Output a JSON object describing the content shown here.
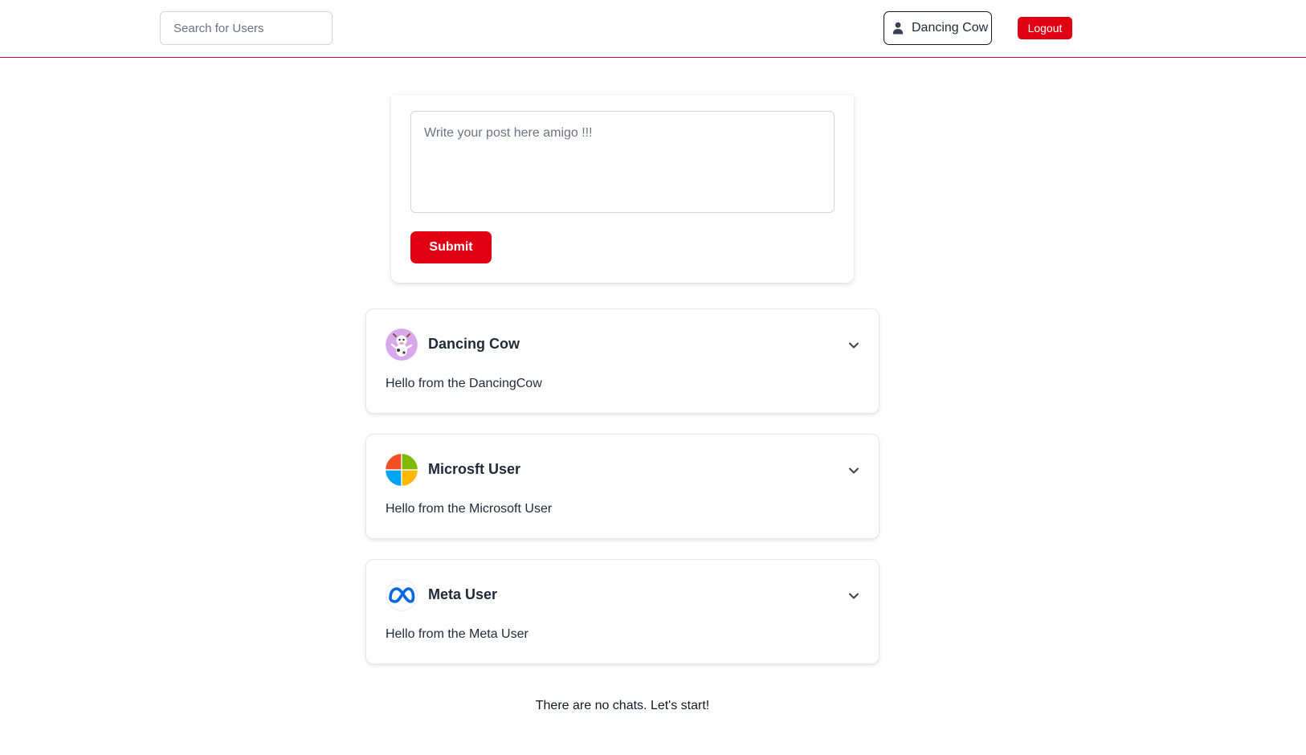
{
  "header": {
    "search_placeholder": "Search for Users",
    "current_user": "Dancing Cow",
    "logout_label": "Logout"
  },
  "composer": {
    "placeholder": "Write your post here amigo !!!",
    "submit_label": "Submit"
  },
  "posts": [
    {
      "author": "Dancing Cow",
      "body": "Hello from the DancingCow",
      "avatar": "cow-avatar"
    },
    {
      "author": "Microsft User",
      "body": "Hello from the Microsoft User",
      "avatar": "microsoft-logo"
    },
    {
      "author": "Meta User",
      "body": "Hello from the Meta User",
      "avatar": "meta-logo"
    }
  ],
  "chats": {
    "empty_message": "There are no chats. Let's start!"
  },
  "colors": {
    "accent": "#e00012",
    "header_border": "#c8102e",
    "text": "#1f2937"
  }
}
